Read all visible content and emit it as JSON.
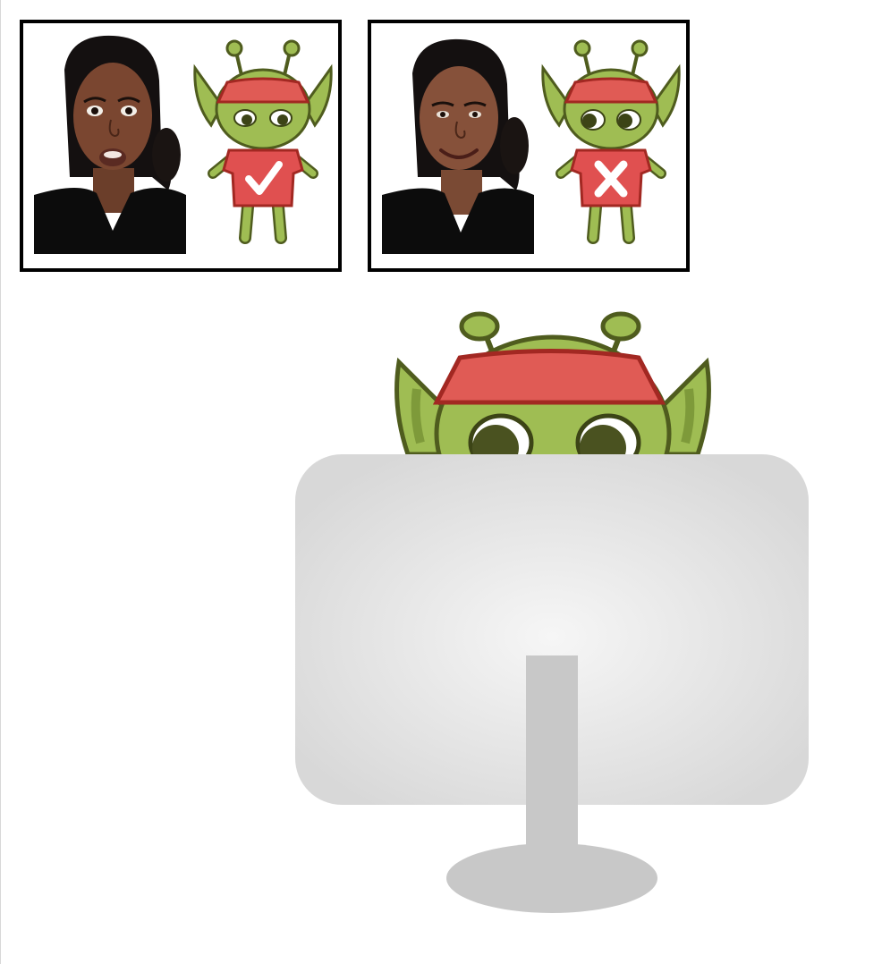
{
  "cards": [
    {
      "name": "surprised-expression",
      "feedback": "correct"
    },
    {
      "name": "happy-expression",
      "feedback": "incorrect"
    }
  ],
  "colors": {
    "alien_green": "#9fbd53",
    "alien_outline": "#4f5c1e",
    "band_red": "#e05b55",
    "shirt_red": "#e05050",
    "monitor_gray": "#dcdcdc",
    "stand_gray": "#c8c8c8"
  },
  "icons": [
    "check-icon",
    "cross-icon"
  ]
}
